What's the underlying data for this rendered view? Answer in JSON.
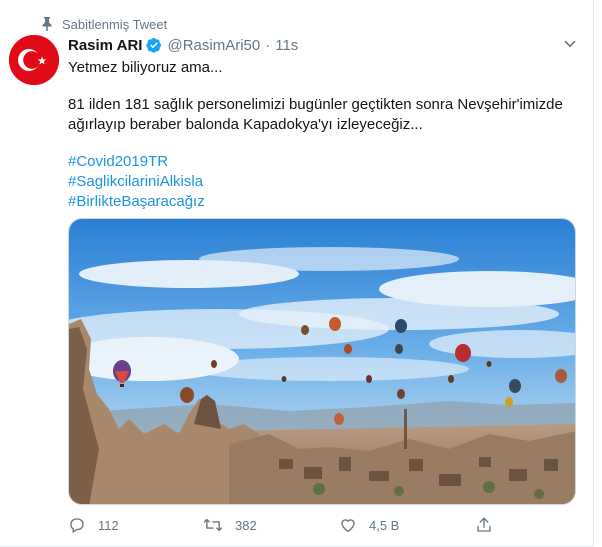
{
  "pinned_label": "Sabitlenmiş Tweet",
  "author": {
    "name": "Rasim ARI",
    "handle": "@RasimAri50",
    "time": "11s",
    "separator": "·"
  },
  "tweet": {
    "line1": "Yetmez biliyoruz ama...",
    "line2": "81 ilden 181 sağlık personelimizi bugünler geçtikten sonra Nevşehir'imizde ağırlayıp beraber balonda Kapadokya'yı izleyeceğiz...",
    "hashtags": [
      "#Covid2019TR",
      "#SaglikcilariniAlkisla",
      "#BirlikteBaşaracağız"
    ]
  },
  "actions": {
    "replies": "112",
    "retweets": "382",
    "likes": "4,5 B"
  },
  "icons": {
    "pin": "pin-icon",
    "verified": "verified-badge-icon",
    "caret": "chevron-down-icon",
    "reply": "reply-icon",
    "retweet": "retweet-icon",
    "like": "heart-icon",
    "share": "share-icon"
  },
  "colors": {
    "text": "#14171a",
    "secondary": "#657786",
    "link": "#1b95e0",
    "verified": "#1da1f2",
    "flag_red": "#e30a17"
  }
}
